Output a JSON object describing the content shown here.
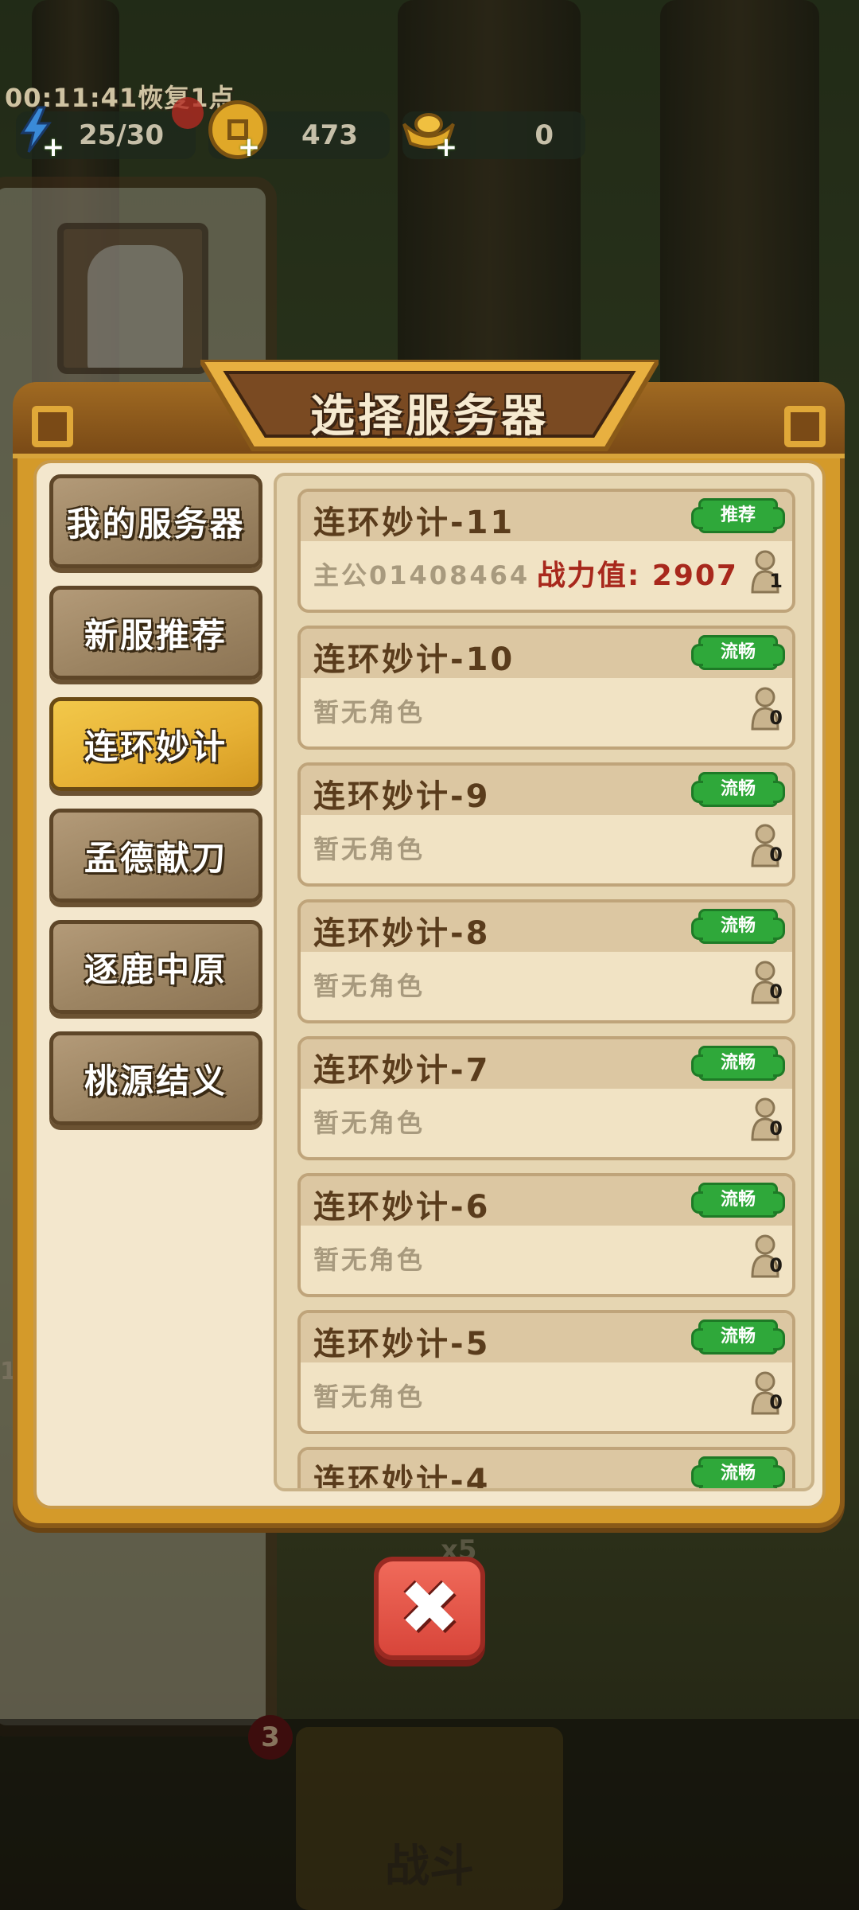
{
  "hud": {
    "timer": "00:11:41恢复1点",
    "stamina": "25/30",
    "coins": "473",
    "ingots": "0",
    "stamina_icon": "lightning-icon",
    "coin_icon": "coin-icon",
    "ingot_icon": "gold-ingot-icon"
  },
  "dialog": {
    "title": "选择服务器"
  },
  "categories": [
    {
      "label": "我的服务器",
      "active": false
    },
    {
      "label": "新服推荐",
      "active": false
    },
    {
      "label": "连环妙计",
      "active": true
    },
    {
      "label": "孟德献刀",
      "active": false
    },
    {
      "label": "逐鹿中原",
      "active": false
    },
    {
      "label": "桃源结义",
      "active": false
    }
  ],
  "servers": [
    {
      "name": "连环妙计-11",
      "tag": "推荐",
      "info": "主公01408464",
      "power": "战力值: 2907",
      "count": "1"
    },
    {
      "name": "连环妙计-10",
      "tag": "流畅",
      "info": "暂无角色",
      "power": "",
      "count": "0"
    },
    {
      "name": "连环妙计-9",
      "tag": "流畅",
      "info": "暂无角色",
      "power": "",
      "count": "0"
    },
    {
      "name": "连环妙计-8",
      "tag": "流畅",
      "info": "暂无角色",
      "power": "",
      "count": "0"
    },
    {
      "name": "连环妙计-7",
      "tag": "流畅",
      "info": "暂无角色",
      "power": "",
      "count": "0"
    },
    {
      "name": "连环妙计-6",
      "tag": "流畅",
      "info": "暂无角色",
      "power": "",
      "count": "0"
    },
    {
      "name": "连环妙计-5",
      "tag": "流畅",
      "info": "暂无角色",
      "power": "",
      "count": "0"
    },
    {
      "name": "连环妙计-4",
      "tag": "流畅",
      "info": "",
      "power": "",
      "count": ""
    }
  ],
  "background": {
    "battle_label": "战斗",
    "badge_count": "3",
    "side_number": "1",
    "reward_multiplier": "x5"
  },
  "close_icon": "close-icon",
  "colors": {
    "accent_gold": "#e6b034",
    "tag_green": "#2fa83a",
    "power_red": "#a8281c",
    "close_red": "#d8453a"
  }
}
